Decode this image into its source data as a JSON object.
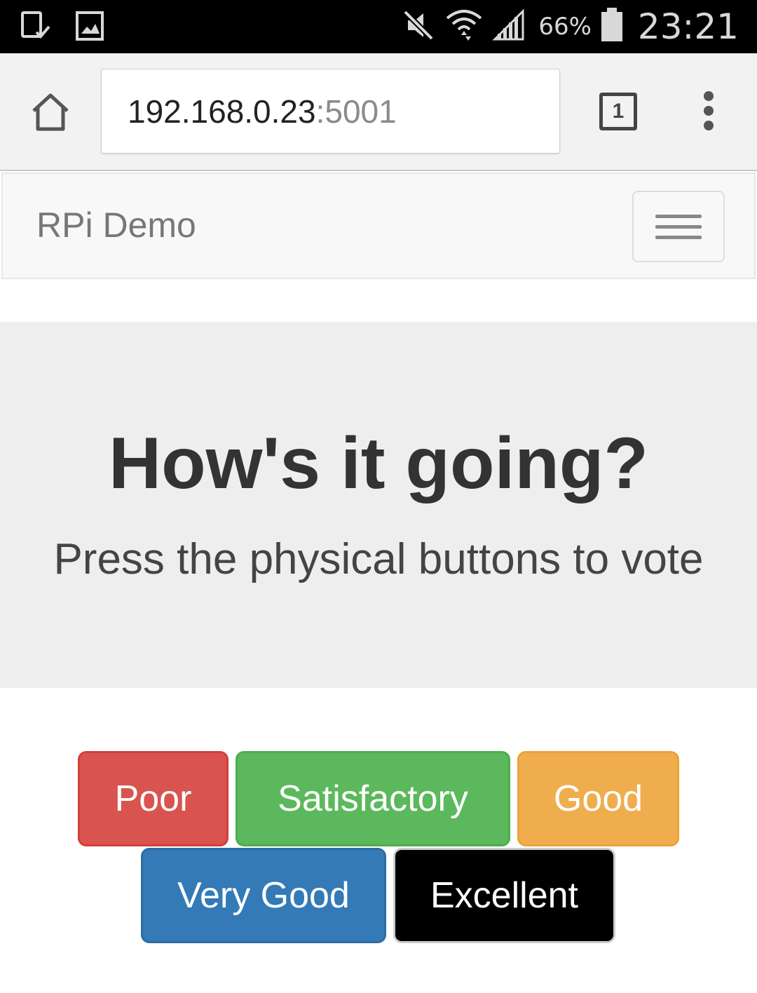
{
  "status_bar": {
    "icons_left": [
      "tablet-check-icon",
      "image-icon"
    ],
    "icons_right": [
      "mute-icon",
      "wifi-icon",
      "signal-icon"
    ],
    "battery_percent": "66%",
    "battery_icon": "battery-icon",
    "time": "23:21"
  },
  "browser": {
    "url_host": "192.168.0.23",
    "url_port": ":5001",
    "tab_count": "1",
    "home_icon": "home-icon",
    "menu_icon": "overflow-menu-icon"
  },
  "navbar": {
    "brand": "RPi Demo",
    "toggle_icon": "hamburger-menu-icon"
  },
  "jumbotron": {
    "title": "How's it going?",
    "subtitle": "Press the physical buttons to vote"
  },
  "vote_buttons": [
    {
      "label": "Poor",
      "color": "#d9534f"
    },
    {
      "label": "Satisfactory",
      "color": "#5cb85c"
    },
    {
      "label": "Good",
      "color": "#f0ad4e"
    },
    {
      "label": "Very Good",
      "color": "#337ab7"
    },
    {
      "label": "Excellent",
      "color": "#000000"
    }
  ]
}
